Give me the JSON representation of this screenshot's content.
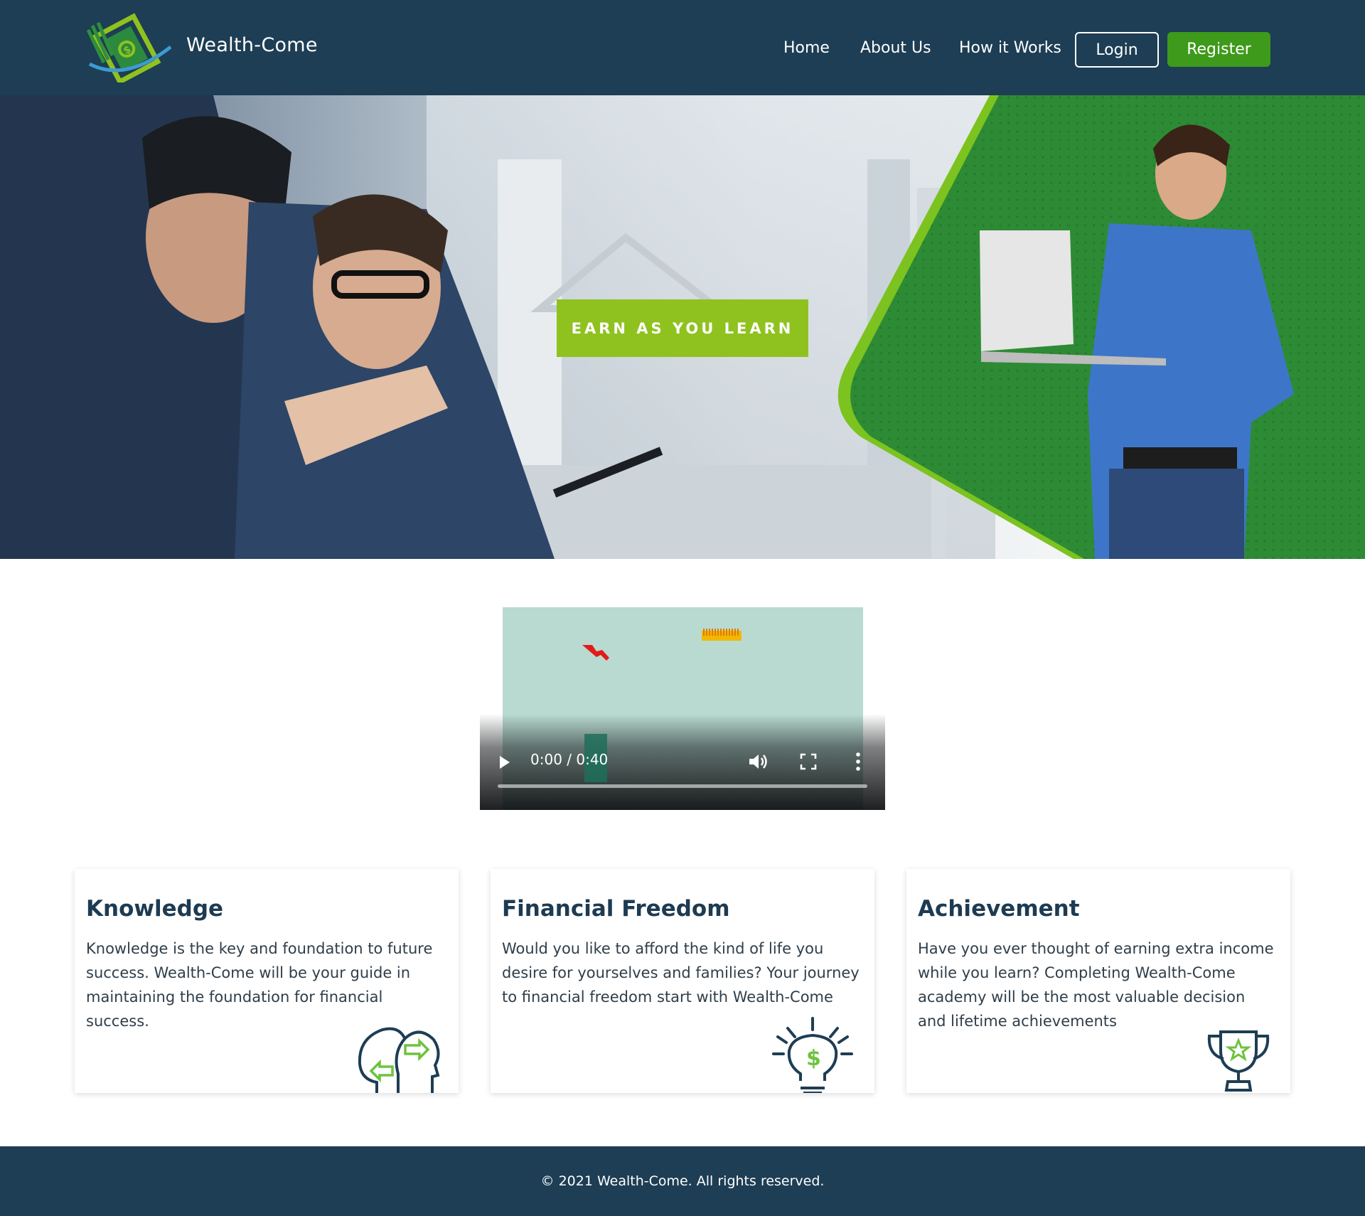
{
  "header": {
    "brand": "Wealth-Come",
    "nav": {
      "home": "Home",
      "about": "About Us",
      "how": "How it Works"
    },
    "login_label": "Login",
    "register_label": "Register",
    "logo_icon": "money-bill-orbit-logo"
  },
  "hero": {
    "cta_label": "EARN AS YOU LEARN"
  },
  "video": {
    "time": "0:00 / 0:40",
    "progress": 0,
    "icons": [
      "play-icon",
      "volume-icon",
      "fullscreen-icon",
      "more-options-icon"
    ]
  },
  "cards": [
    {
      "title": "Knowledge",
      "text": "Knowledge is the key and foundation to future success. Wealth-Come will be your guide in maintaining the foundation for financial success.",
      "icon": "head-exchange-icon"
    },
    {
      "title": "Financial Freedom",
      "text": "Would you like to afford the kind of life you desire for yourselves and families? Your journey to financial freedom start with Wealth-Come",
      "icon": "dollar-lightbulb-icon"
    },
    {
      "title": "Achievement",
      "text": "Have you ever thought of earning extra income while you learn? Completing Wealth-Come academy will be the most valuable decision and lifetime achievements",
      "icon": "trophy-icon"
    }
  ],
  "footer": {
    "copyright": "© 2021 Wealth-Come. All rights reserved."
  },
  "colors": {
    "header_bg": "#1d3e54",
    "accent_green": "#3e9a1a",
    "cta_green": "#8fc21f",
    "hero_green": "#2e8b35",
    "video_bg": "#b9dad1"
  }
}
